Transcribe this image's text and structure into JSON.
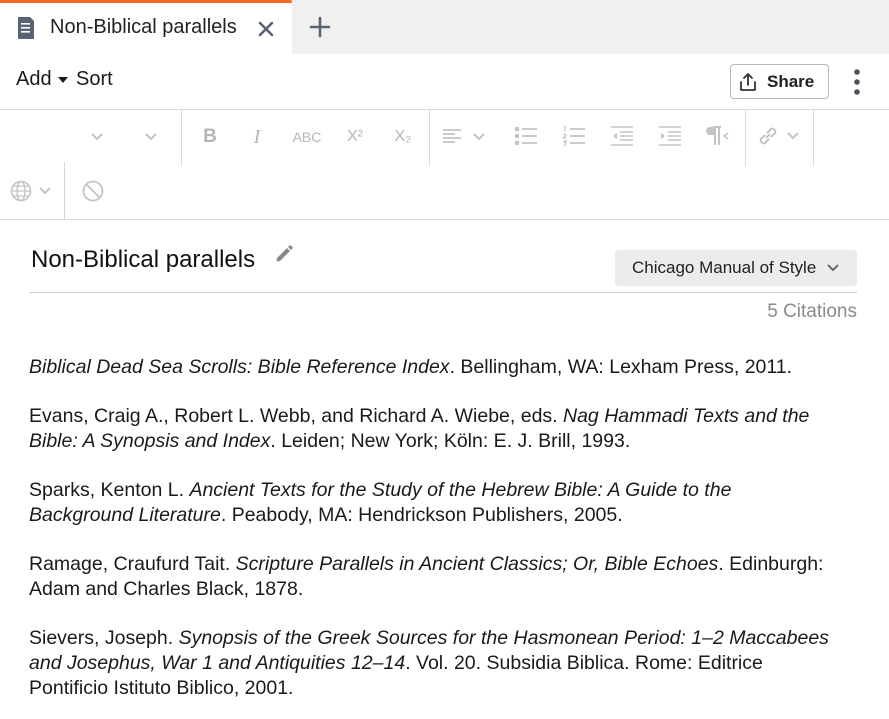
{
  "tab": {
    "title": "Non-Biblical parallels",
    "accent_color": "#f26a21"
  },
  "actionbar": {
    "add_label": "Add",
    "sort_label": "Sort",
    "share_label": "Share"
  },
  "toolbar": {
    "strikethrough_label": "ABC",
    "superscript_label": "X²",
    "subscript_label": "X₂"
  },
  "document": {
    "title": "Non-Biblical parallels",
    "citation_style": "Chicago Manual of Style",
    "citation_count": "5 Citations"
  },
  "citations": [
    {
      "parts": [
        {
          "t": "Biblical Dead Sea Scrolls: Bible Reference Index",
          "i": true
        },
        {
          "t": ". Bellingham, WA: Lexham Press, 2011.",
          "i": false
        }
      ]
    },
    {
      "parts": [
        {
          "t": "Evans, Craig A., Robert L. Webb, and Richard A. Wiebe, eds. ",
          "i": false
        },
        {
          "t": "Nag Hammadi Texts and the Bible: A Synopsis and Index",
          "i": true
        },
        {
          "t": ". Leiden; New York; Köln: E. J. Brill, 1993.",
          "i": false
        }
      ]
    },
    {
      "parts": [
        {
          "t": "Sparks, Kenton L. ",
          "i": false
        },
        {
          "t": "Ancient Texts for the Study of the Hebrew Bible: A Guide to the Background Literature",
          "i": true
        },
        {
          "t": ". Peabody, MA: Hendrickson Publishers, 2005.",
          "i": false
        }
      ]
    },
    {
      "parts": [
        {
          "t": "Ramage, Craufurd Tait. ",
          "i": false
        },
        {
          "t": "Scripture Parallels in Ancient Classics; Or, Bible Echoes",
          "i": true
        },
        {
          "t": ". Edinburgh: Adam and Charles Black, 1878.",
          "i": false
        }
      ]
    },
    {
      "parts": [
        {
          "t": "Sievers, Joseph. ",
          "i": false
        },
        {
          "t": "Synopsis of the Greek Sources for the Hasmonean Period: 1–2 Maccabees and Josephus, War 1 and Antiquities 12–14",
          "i": true
        },
        {
          "t": ". Vol. 20. Subsidia Biblica. Rome: Editrice Pontificio Istituto Biblico, 2001.",
          "i": false
        }
      ]
    }
  ]
}
